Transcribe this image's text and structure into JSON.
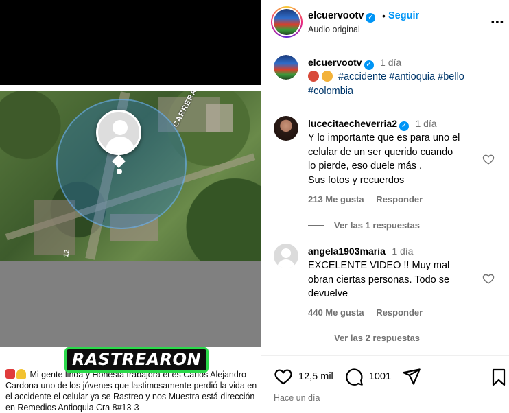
{
  "media": {
    "map_street_label": "CARRERA 8",
    "map_number_label": "12",
    "overlay_title": "RASTREARON",
    "caption": "Mi gente linda y Honesta trabajora el es Carlos Alejandro Cardona uno de los jóvenes que lastimosamente perdió la vida en el accidente el celular ya se Rastreo y nos Muestra está dirección en Remedios Antioquia Cra 8#13-3"
  },
  "header": {
    "username": "elcuervootv",
    "separator": "•",
    "follow_label": "Seguir",
    "audio_label": "Audio original",
    "more_icon": "more-horizontal-icon"
  },
  "post": {
    "username": "elcuervootv",
    "time": "1 día",
    "hashtags": [
      "#accidente",
      "#antioquia",
      "#bello",
      "#colombia"
    ]
  },
  "comments": [
    {
      "username": "lucecitaecheverria2",
      "verified": true,
      "time": "1 día",
      "lines": [
        "Y lo importante que es para uno el",
        "celular de un ser querido cuando",
        "lo pierde, eso duele más .",
        "Sus fotos y recuerdos"
      ],
      "likes": "213 Me gusta",
      "reply_label": "Responder",
      "view_replies": "Ver las 1 respuestas"
    },
    {
      "username": "angela1903maria",
      "verified": false,
      "time": "1 día",
      "lines": [
        "EXCELENTE VIDEO !! Muy mal",
        "obran ciertas personas. Todo se",
        "devuelve"
      ],
      "likes": "440 Me gusta",
      "reply_label": "Responder",
      "view_replies": "Ver las 2 respuestas"
    }
  ],
  "footer": {
    "likes_count": "12,5 mil",
    "comments_count": "1001",
    "posted_ago": "Hace un día"
  },
  "colors": {
    "accent": "#0095f6",
    "muted_text": "#737373",
    "hashtag": "#00376b",
    "overlay_border": "#2bd94b"
  }
}
